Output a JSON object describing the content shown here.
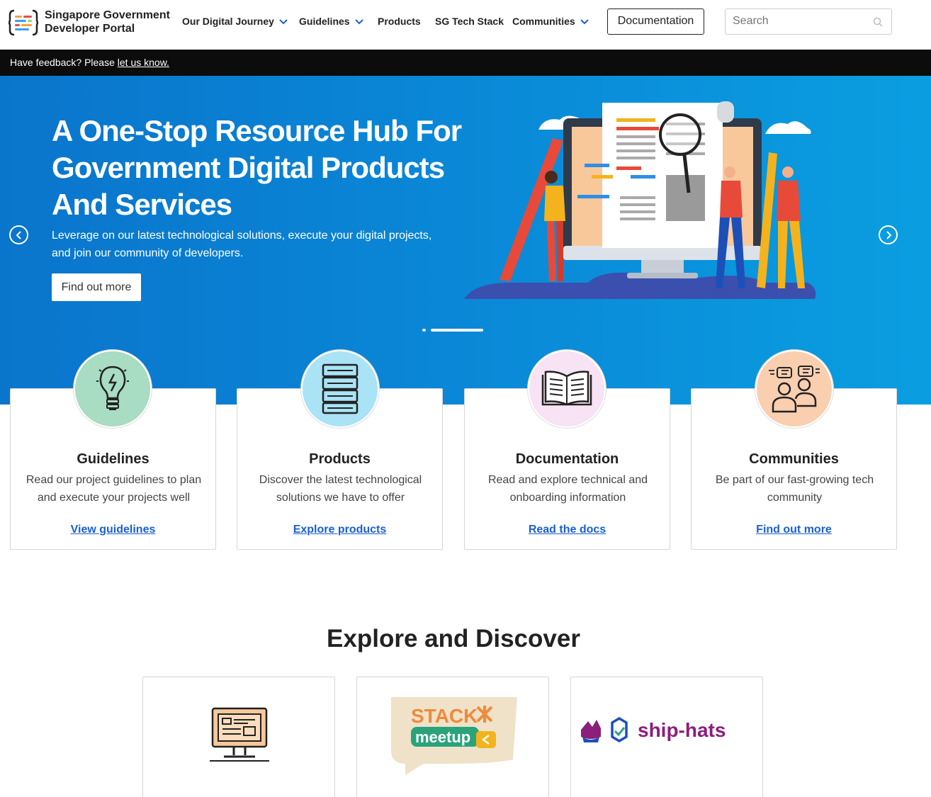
{
  "header": {
    "logo_line1": "Singapore Government",
    "logo_line2": "Developer Portal",
    "nav": {
      "journey": "Our Digital Journey",
      "guidelines": "Guidelines",
      "products": "Products",
      "techstack": "SG Tech Stack",
      "communities": "Communities"
    },
    "documentation_button": "Documentation",
    "search_placeholder": "Search"
  },
  "feedback": {
    "prefix": "Have feedback? Please ",
    "link": "let us know."
  },
  "hero": {
    "title_line1": "A One-Stop Resource Hub For",
    "title_line2": "Government Digital Products",
    "title_line3": "And Services",
    "subtitle_line1": "Leverage on our latest technological solutions, execute your digital projects,",
    "subtitle_line2": "and join our community of developers.",
    "button": "Find out more"
  },
  "cards": [
    {
      "title": "Guidelines",
      "desc1": "Read our project guidelines to plan",
      "desc2": "and execute your projects well",
      "link": "View guidelines",
      "icon": "lightbulb-icon",
      "color": "#a8dcc3"
    },
    {
      "title": "Products",
      "desc1": "Discover the latest technological",
      "desc2": "solutions we have to offer",
      "link": "Explore products",
      "icon": "server-stack-icon",
      "color": "#a9e3f5"
    },
    {
      "title": "Documentation",
      "desc1": "Read and explore technical and",
      "desc2": "onboarding information",
      "link": "Read the docs",
      "icon": "open-book-icon",
      "color": "#f7e3f3"
    },
    {
      "title": "Communities",
      "desc1": "Be part of our fast-growing tech",
      "desc2": "community",
      "link": "Find out more",
      "icon": "people-chat-icon",
      "color": "#f9cfb0"
    }
  ],
  "explore": {
    "title": "Explore and Discover",
    "items": [
      {
        "icon": "computer-monitor-icon"
      },
      {
        "logo_line1": "STACK",
        "logo_line2": "meetup"
      },
      {
        "logo_text": "ship-hats"
      }
    ]
  },
  "colors": {
    "hero_blue": "#0a86d6",
    "link_blue": "#1a5fd1",
    "feedback_bar": "#0c0c0c"
  }
}
